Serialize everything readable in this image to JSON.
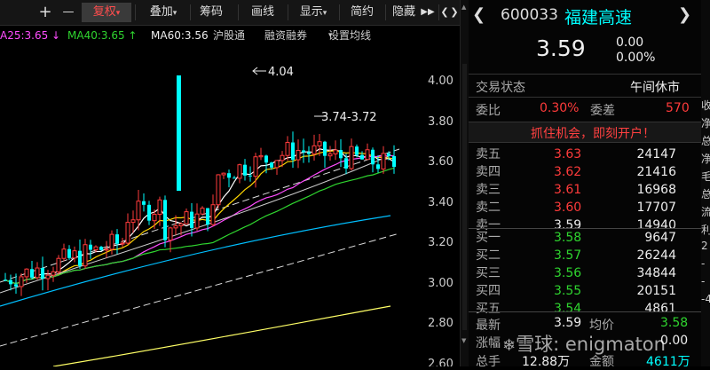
{
  "toolbar": {
    "plus": "+",
    "minus": "—",
    "fuquan": "复权",
    "diejia": "叠加",
    "chouma": "筹码",
    "huaxian": "画线",
    "xianshi": "显示",
    "jianyue": "简约",
    "yincang": "隐藏",
    "more": "▶▶",
    "back": "❮",
    "fwd": "❯"
  },
  "ma": {
    "ma25": "A25:3.65 ↓",
    "ma40": "MA40:3.65 ↑",
    "ma60": "MA60:3.56",
    "hgt": "沪股通",
    "rzrq": "融资融券",
    "szjx": "设置均线",
    "szjx_caret": "▾"
  },
  "chart_data": {
    "type": "candlestick",
    "y_ticks": [
      "4.00",
      "3.80",
      "3.60",
      "3.40",
      "3.20",
      "3.00",
      "2.80",
      "2.60"
    ],
    "ylim": [
      2.55,
      4.1
    ],
    "annotations": {
      "high": "4.04",
      "range": "3.74-3.72"
    }
  },
  "stock": {
    "code": "600033",
    "name": "福建高速",
    "price": "3.59",
    "change": "0.00",
    "change_pct": "0.00%",
    "status_label": "交易状态",
    "status_value": "午间休市",
    "weibi_label": "委比",
    "weibi_value": "0.30%",
    "weicha_label": "委差",
    "weicha_value": "570",
    "promo": "抓住机会，即刻开户！"
  },
  "sells": [
    {
      "label": "卖五",
      "price": "3.63",
      "vol": "24147"
    },
    {
      "label": "卖四",
      "price": "3.62",
      "vol": "21416"
    },
    {
      "label": "卖三",
      "price": "3.61",
      "vol": "16968"
    },
    {
      "label": "卖二",
      "price": "3.60",
      "vol": "17707"
    },
    {
      "label": "卖一",
      "price": "3.59",
      "vol": "14940"
    }
  ],
  "buys": [
    {
      "label": "买一",
      "price": "3.58",
      "vol": "9647"
    },
    {
      "label": "买二",
      "price": "3.57",
      "vol": "26244"
    },
    {
      "label": "买三",
      "price": "3.56",
      "vol": "34844"
    },
    {
      "label": "买四",
      "price": "3.55",
      "vol": "20151"
    },
    {
      "label": "买五",
      "price": "3.54",
      "vol": "4861"
    }
  ],
  "summary": {
    "latest_label": "最新",
    "latest_value": "3.59",
    "avg_label": "均价",
    "avg_value": "3.58",
    "zf_label": "涨幅",
    "zf_value": "",
    "zd_value": "0.00",
    "zs_label": "总手",
    "zs_value": "12.88万",
    "je_label": "金额",
    "je_value": "4611万"
  },
  "watermark": "雪球: enigmaton",
  "far_right": [
    "收",
    "净",
    "总",
    "净",
    "毛",
    "总",
    "流",
    "利",
    "2",
    "-",
    "-",
    "-4"
  ],
  "colors": {
    "accent": "#ff3b3b",
    "fall": "#00ffff",
    "title": "#00ffff"
  }
}
